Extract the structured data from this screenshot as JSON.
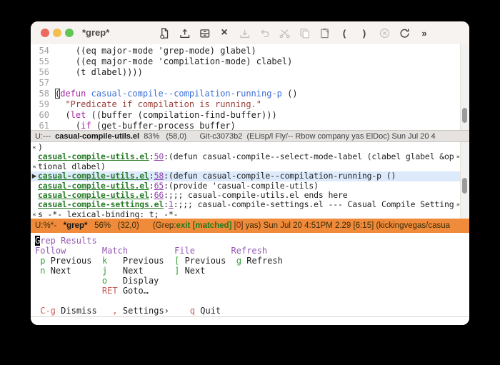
{
  "window": {
    "title": "*grep*"
  },
  "toolbar": {
    "glyphs": {
      "close": "×",
      "lparen": "(",
      "rparen": ")",
      "overflow": "»"
    },
    "icons": [
      "new-file-icon",
      "open-icon",
      "save-icon",
      "close-buffer-icon",
      "import-icon",
      "undo-icon",
      "cut-icon",
      "copy-icon",
      "paste-icon",
      "paren-open-icon",
      "paren-close-icon",
      "cancel-icon",
      "refresh-icon",
      "overflow-icon"
    ]
  },
  "code_pane": {
    "lines": [
      {
        "num": "54",
        "segs": [
          {
            "t": "    ((eq major-mode 'grep-mode) glabel)"
          }
        ]
      },
      {
        "num": "55",
        "segs": [
          {
            "t": "    ((eq major-mode 'compilation-mode) clabel)"
          }
        ]
      },
      {
        "num": "56",
        "segs": [
          {
            "t": "    (t dlabel))))"
          }
        ]
      },
      {
        "num": "57",
        "segs": [
          {
            "t": ""
          }
        ]
      },
      {
        "num": "58",
        "segs": [
          {
            "t": "(",
            "c": "hcur"
          },
          {
            "t": "defun",
            "c": "kw"
          },
          {
            "t": " "
          },
          {
            "t": "casual-compile--compilation-running-p",
            "c": "fn"
          },
          {
            "t": " ()"
          }
        ]
      },
      {
        "num": "59",
        "segs": [
          {
            "t": "  "
          },
          {
            "t": "\"Predicate if compilation is running.\"",
            "c": "str"
          }
        ]
      },
      {
        "num": "60",
        "segs": [
          {
            "t": "  ("
          },
          {
            "t": "let",
            "c": "kw"
          },
          {
            "t": " ((buffer (compilation-find-buffer)))"
          }
        ]
      },
      {
        "num": "61",
        "segs": [
          {
            "t": "    ("
          },
          {
            "t": "if",
            "c": "kw"
          },
          {
            "t": " (get-buffer-process buffer)"
          }
        ]
      }
    ]
  },
  "modeline1": {
    "segs": [
      {
        "t": "U:---"
      },
      {
        "t": "  "
      },
      {
        "t": "casual-compile-utils.el",
        "c": "mlb"
      },
      {
        "t": "  83%   (58,0)      Git-c3073b2  (ELisp/l Fly/-- Rbow company yas ElDoc) Sun Jul 20 4"
      }
    ]
  },
  "grep_pane": {
    "lines": [
      {
        "fringe": "«",
        "segs": [
          {
            "t": ")"
          }
        ]
      },
      {
        "segs": [
          {
            "t": "casual-compile-utils.el",
            "c": "gfn"
          },
          {
            "t": ":"
          },
          {
            "t": "50",
            "c": "gln"
          },
          {
            "t": ":"
          },
          {
            "t": "(defun casual-compile--select-mode-label (clabel glabel &op"
          }
        ],
        "wrap": "»"
      },
      {
        "fringe": "«",
        "segs": [
          {
            "t": "tional dlabel)"
          }
        ]
      },
      {
        "cls": "hl",
        "fringe": "▶",
        "segs": [
          {
            "t": "casual-compile-utils.el",
            "c": "gfn"
          },
          {
            "t": ":"
          },
          {
            "t": "58",
            "c": "gln"
          },
          {
            "t": ":"
          },
          {
            "t": "(defun casual-compile--compilation-running-p ()"
          }
        ]
      },
      {
        "segs": [
          {
            "t": "casual-compile-utils.el",
            "c": "gfn"
          },
          {
            "t": ":"
          },
          {
            "t": "65",
            "c": "gln"
          },
          {
            "t": ":"
          },
          {
            "t": "(provide 'casual-compile-utils)"
          }
        ]
      },
      {
        "segs": [
          {
            "t": "casual-compile-utils.el",
            "c": "gfn"
          },
          {
            "t": ":"
          },
          {
            "t": "66",
            "c": "gln"
          },
          {
            "t": ":"
          },
          {
            "t": ";;; casual-compile-utils.el ends here"
          }
        ]
      },
      {
        "segs": [
          {
            "t": "casual-compile-settings.el",
            "c": "gfn"
          },
          {
            "t": ":"
          },
          {
            "t": "1",
            "c": "gln"
          },
          {
            "t": ":"
          },
          {
            "t": ";;; casual-compile-settings.el --- Casual Compile Setting"
          }
        ],
        "wrap": "»"
      },
      {
        "fringe": "«",
        "segs": [
          {
            "t": "s -*- lexical-binding: t; -*-"
          }
        ]
      }
    ]
  },
  "modeline2": {
    "segs": [
      {
        "t": "U:%*-"
      },
      {
        "t": "   "
      },
      {
        "t": "*grep*",
        "c": "mlb"
      },
      {
        "t": "   56%   (32,0)      (Grep:"
      },
      {
        "t": "exit [matched]",
        "c": "grn"
      },
      {
        "t": " ["
      },
      {
        "t": "0",
        "c": "red0"
      },
      {
        "t": "] yas) Sun Jul 20 4:51PM 2.29 [6:15] (kickingvegas/casua"
      }
    ]
  },
  "transient_pane": {
    "lines": [
      {
        "segs": [
          {
            "t": "G",
            "c": "cur"
          },
          {
            "t": "rep Results",
            "c": "hd"
          }
        ]
      },
      {
        "segs": [
          {
            "t": "Follow       Match         File       Refresh",
            "c": "hd"
          }
        ]
      },
      {
        "segs": [
          {
            "t": " "
          },
          {
            "t": "p",
            "c": "kg"
          },
          {
            "t": " Previous  "
          },
          {
            "t": "k",
            "c": "kg"
          },
          {
            "t": "   Previous  "
          },
          {
            "t": "[",
            "c": "kg"
          },
          {
            "t": " Previous  "
          },
          {
            "t": "g",
            "c": "kg"
          },
          {
            "t": " Refresh"
          }
        ]
      },
      {
        "segs": [
          {
            "t": " "
          },
          {
            "t": "n",
            "c": "kg"
          },
          {
            "t": " Next      "
          },
          {
            "t": "j",
            "c": "kg"
          },
          {
            "t": "   Next      "
          },
          {
            "t": "]",
            "c": "kg"
          },
          {
            "t": " Next"
          }
        ]
      },
      {
        "segs": [
          {
            "t": "             "
          },
          {
            "t": "o",
            "c": "kg"
          },
          {
            "t": "   Display"
          }
        ]
      },
      {
        "segs": [
          {
            "t": "             "
          },
          {
            "t": "RET",
            "c": "kr"
          },
          {
            "t": " Goto…"
          }
        ]
      },
      {
        "segs": [
          {
            "t": ""
          }
        ]
      },
      {
        "segs": [
          {
            "t": " "
          },
          {
            "t": "C-g",
            "c": "kr"
          },
          {
            "t": " Dismiss   "
          },
          {
            "t": ",",
            "c": "kr"
          },
          {
            "t": " Settings›    "
          },
          {
            "t": "q",
            "c": "kr"
          },
          {
            "t": " Quit"
          }
        ]
      }
    ]
  },
  "colors": {
    "modeline_active_bg": "#ef8b3a",
    "grep_file": "#277c27",
    "grep_line_number": "#8f44ad",
    "keyword": "#a626a4",
    "function_name": "#3c6fd6",
    "string": "#9a3b35",
    "transient_heading": "#9558b2",
    "transient_key": "#35a135",
    "transient_exit_key": "#cc5a55",
    "hl_line": "#dceafb"
  }
}
